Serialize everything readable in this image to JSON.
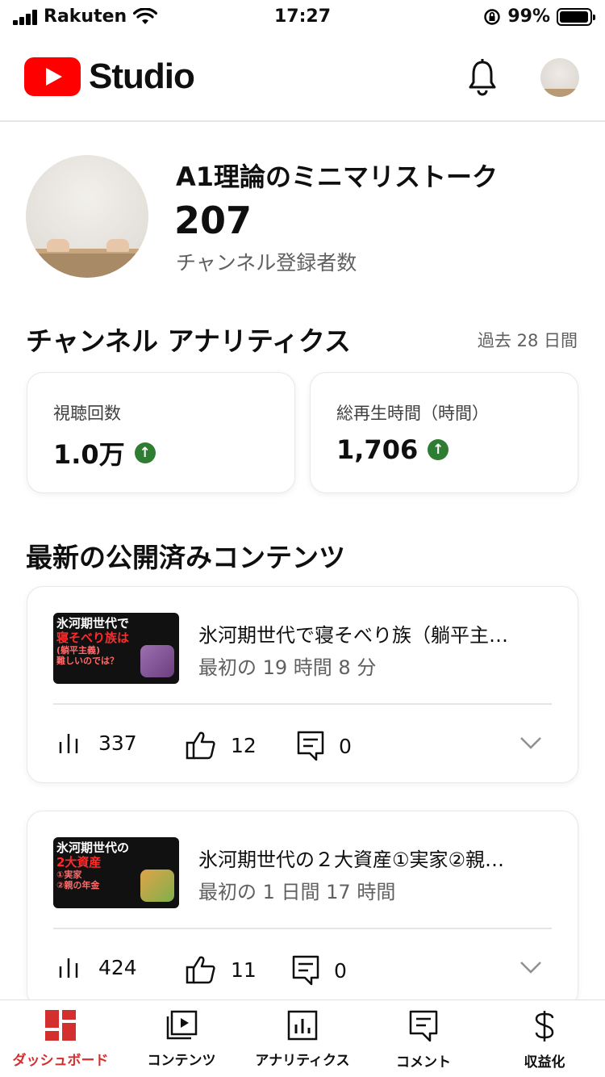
{
  "status_bar": {
    "carrier": "Rakuten",
    "time": "17:27",
    "battery": "99%"
  },
  "header": {
    "logo_text": "Studio",
    "notifications_icon": "bell-icon",
    "account_icon": "avatar"
  },
  "channel": {
    "name": "A1理論のミニマリストーク",
    "subscribers": "207",
    "subscribers_label": "チャンネル登録者数"
  },
  "analytics": {
    "title": "チャンネル アナリティクス",
    "period": "過去 28 日間",
    "metrics": [
      {
        "label": "視聴回数",
        "value": "1.0万",
        "trend": "up"
      },
      {
        "label": "総再生時間（時間）",
        "value": "1,706",
        "trend": "up"
      }
    ]
  },
  "latest": {
    "title": "最新の公開済みコンテンツ",
    "videos": [
      {
        "thumb_lines": [
          "氷河期世代で",
          "寝そべり族は",
          "(躺平主義)",
          "難しいのでは？"
        ],
        "title": "氷河期世代で寝そべり族（躺平主…",
        "meta": "最初の 19 時間 8 分",
        "views": "337",
        "likes": "12",
        "comments": "0"
      },
      {
        "thumb_lines": [
          "氷河期世代の",
          "2大資産",
          "①実家",
          "②親の年金"
        ],
        "title": "氷河期世代の２大資産①実家②親…",
        "meta": "最初の 1 日間 17 時間",
        "views": "424",
        "likes": "11",
        "comments": "0"
      }
    ]
  },
  "nav": {
    "items": [
      {
        "label": "ダッシュボード",
        "icon": "dashboard-icon",
        "active": true
      },
      {
        "label": "コンテンツ",
        "icon": "content-icon",
        "active": false
      },
      {
        "label": "アナリティクス",
        "icon": "analytics-icon",
        "active": false
      },
      {
        "label": "コメント",
        "icon": "comment-icon",
        "active": false
      },
      {
        "label": "収益化",
        "icon": "dollar-icon",
        "active": false
      }
    ]
  },
  "colors": {
    "brand_red": "#ff0000",
    "active_nav": "#d32f2f",
    "trend_up": "#2e7d32"
  }
}
